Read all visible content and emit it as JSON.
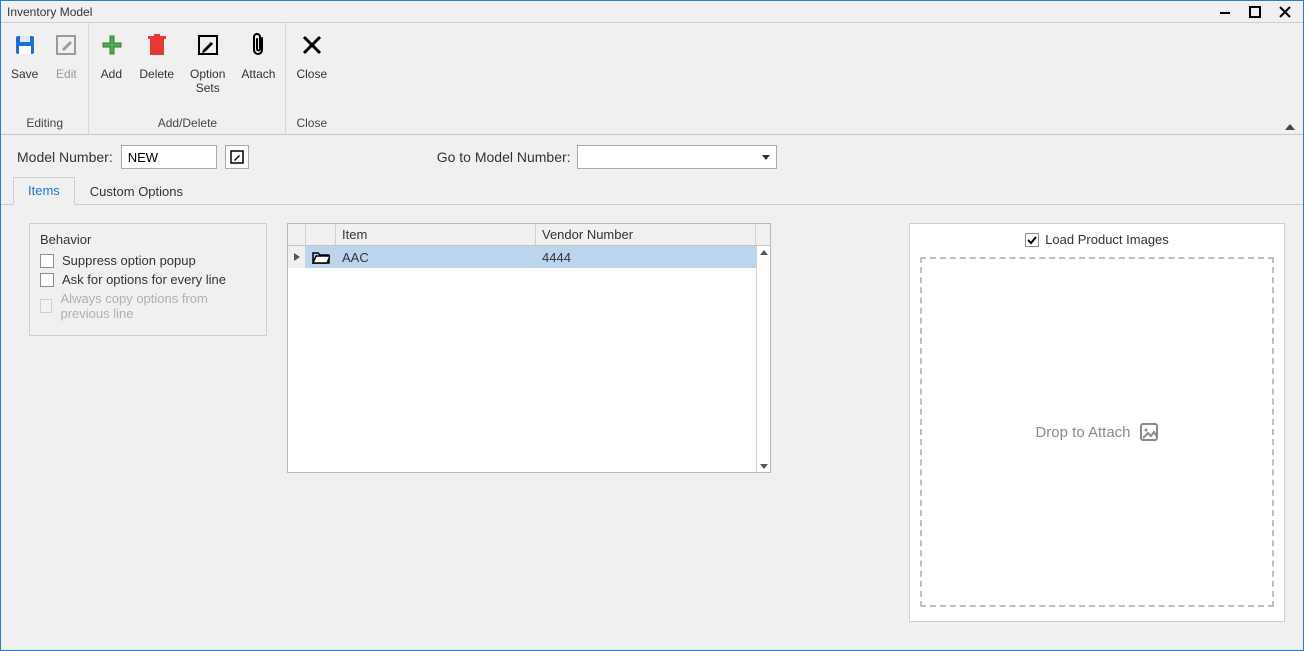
{
  "window": {
    "title": "Inventory Model"
  },
  "ribbon": {
    "groups": {
      "editing": {
        "label": "Editing",
        "save": "Save",
        "edit": "Edit"
      },
      "adddelete": {
        "label": "Add/Delete",
        "add": "Add",
        "delete": "Delete",
        "optionsets": "Option\nSets",
        "attach": "Attach"
      },
      "close": {
        "label": "Close",
        "close": "Close"
      }
    }
  },
  "modelbar": {
    "model_label": "Model Number:",
    "model_value": "NEW",
    "goto_label": "Go to Model Number:",
    "goto_value": ""
  },
  "tabs": {
    "items": "Items",
    "custom": "Custom Options"
  },
  "behavior": {
    "title": "Behavior",
    "suppress": "Suppress option popup",
    "askevery": "Ask for options for every line",
    "copyprev": "Always copy options from previous line"
  },
  "grid": {
    "headers": {
      "item": "Item",
      "vendor": "Vendor Number"
    },
    "rows": [
      {
        "item": "AAC",
        "vendor": "4444"
      }
    ]
  },
  "imagepanel": {
    "load_label": "Load Product Images",
    "load_checked": true,
    "drop_text": "Drop to Attach"
  }
}
